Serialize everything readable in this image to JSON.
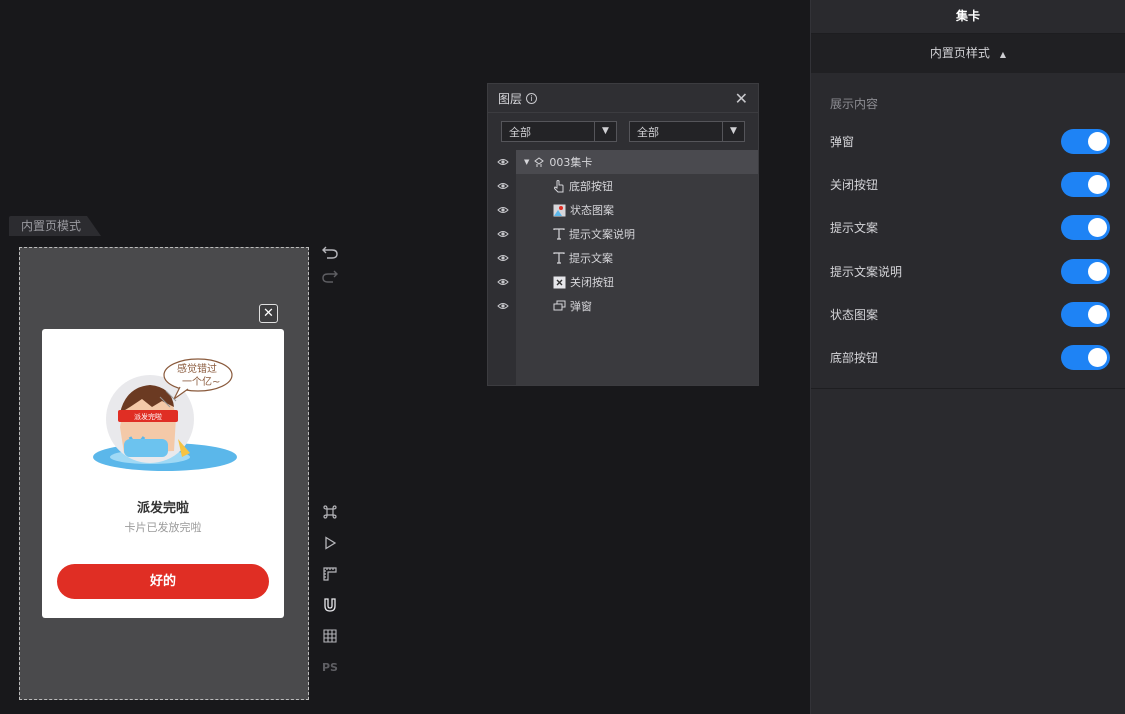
{
  "canvas": {
    "mode_tab": "内置页模式",
    "popup": {
      "bubble_line1": "感觉错过",
      "bubble_line2": "一个亿~",
      "headband": "派发完啦",
      "title": "派发完啦",
      "desc": "卡片已发放完啦",
      "button": "好的",
      "button_color": "#e02e24"
    },
    "close_glyph": "✕"
  },
  "toolbar": {
    "undo_icon": "undo-icon",
    "redo_icon": "redo-icon",
    "tools": [
      "command-icon",
      "play-icon",
      "ruler-icon",
      "magnet-icon",
      "grid-icon",
      "ps-icon"
    ],
    "ps_label": "PS"
  },
  "layers": {
    "title": "图层",
    "filter1": "全部",
    "filter2": "全部",
    "items": [
      {
        "label": "003集卡",
        "icon": "component-icon",
        "expanded": true
      },
      {
        "label": "底部按钮",
        "icon": "hand-pointer-icon"
      },
      {
        "label": "状态图案",
        "icon": "image-icon"
      },
      {
        "label": "提示文案说明",
        "icon": "text-icon"
      },
      {
        "label": "提示文案",
        "icon": "text-icon"
      },
      {
        "label": "关闭按钮",
        "icon": "close-box-icon"
      },
      {
        "label": "弹窗",
        "icon": "layers-icon"
      }
    ]
  },
  "right_panel": {
    "title": "集卡",
    "sub_title": "内置页样式",
    "section": "展示内容",
    "accent": "#1e83f5",
    "toggles": [
      {
        "label": "弹窗",
        "on": true
      },
      {
        "label": "关闭按钮",
        "on": true
      },
      {
        "label": "提示文案",
        "on": true
      },
      {
        "label": "提示文案说明",
        "on": true
      },
      {
        "label": "状态图案",
        "on": true
      },
      {
        "label": "底部按钮",
        "on": true
      }
    ]
  }
}
